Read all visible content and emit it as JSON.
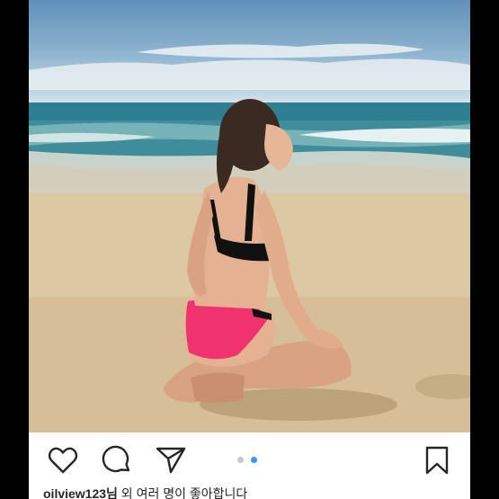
{
  "post": {
    "photo_alt": "",
    "carousel": {
      "count": 2,
      "active_index": 1
    },
    "actions": {
      "like_icon": "heart-icon",
      "comment_icon": "comment-icon",
      "share_icon": "paper-plane-icon",
      "save_icon": "bookmark-icon"
    },
    "caption": {
      "username": "oilview123님",
      "text": " 외 여러 명이 좋아합니다"
    },
    "colors": {
      "accent": "#3897f0",
      "icon": "#262626",
      "background": "#ffffff",
      "frame": "#000000"
    }
  }
}
